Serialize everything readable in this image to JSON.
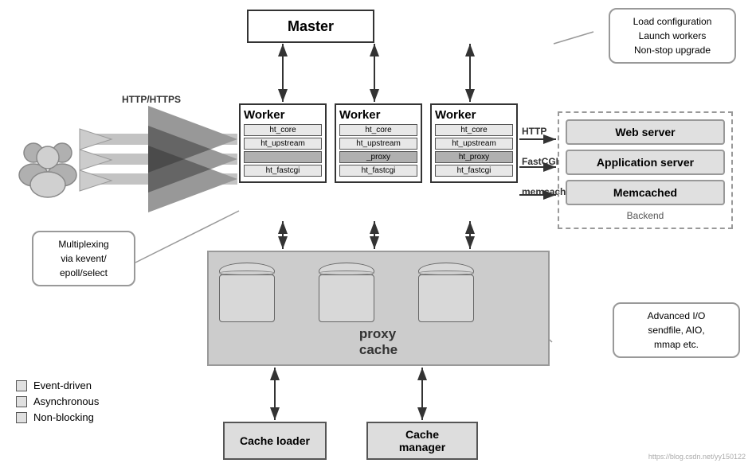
{
  "master": {
    "label": "Master"
  },
  "callout_top": {
    "text": "Load configuration\nLaunch workers\nNon-stop upgrade"
  },
  "workers": [
    {
      "label": "Worker",
      "modules": [
        "ht_core",
        "ht_upstream",
        "",
        "ht_fastcgi"
      ]
    },
    {
      "label": "Worker",
      "modules": [
        "ht_core",
        "ht_upstream",
        "_proxy",
        "ht_fastcgi"
      ]
    },
    {
      "label": "Worker",
      "modules": [
        "ht_core",
        "ht_upstream",
        "ht_proxy",
        "ht_fastcgi"
      ]
    }
  ],
  "proxy_cache": {
    "label": "proxy\ncache"
  },
  "backend": {
    "items": [
      "Web server",
      "Application server",
      "Memcached"
    ],
    "label": "Backend"
  },
  "http_labels": {
    "http": "HTTP",
    "fastcgi": "FastCGI",
    "memcache": "memcache"
  },
  "cache_loader": {
    "label": "Cache loader"
  },
  "cache_manager": {
    "label": "Cache manager"
  },
  "legend": {
    "items": [
      "Event-driven",
      "Asynchronous",
      "Non-blocking"
    ]
  },
  "callout_left": {
    "text": "Multiplexing\nvia kevent/\nepoll/select"
  },
  "callout_bottomright": {
    "text": "Advanced I/O\nsendfile, AIO,\nmmap etc."
  },
  "watermark": "https://blog.csdn.net/yy150122"
}
